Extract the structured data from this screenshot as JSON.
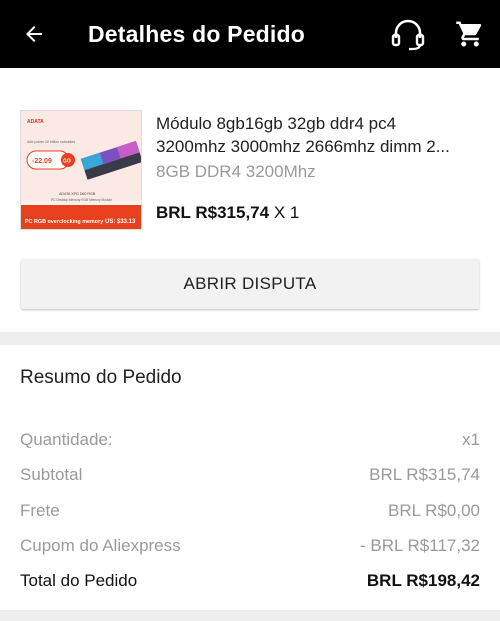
{
  "header": {
    "title": "Detalhes do Pedido"
  },
  "product": {
    "name_line1": "Módulo 8gb16gb 32gb ddr4 pc4",
    "name_line2": "3200mhz 3000mhz 2666mhz dimm 2...",
    "variant": "8GB DDR4 3200Mhz",
    "price": "BRL R$315,74",
    "qty": "X 1",
    "thumb": {
      "brand": "ADATA",
      "promo": "Add points 10 billion subsidies",
      "price_tag": "-22.09",
      "go": "GO",
      "subtitle1": "ADATA XPG D60 RGB",
      "subtitle2": "PC Desktop Memory RGB Memory Module",
      "banner": "PC RGB overclocking memory",
      "us_price": "US: $33.13"
    }
  },
  "dispute_button": "ABRIR DISPUTA",
  "summary": {
    "title": "Resumo do Pedido",
    "rows": [
      {
        "label": "Quantidade:",
        "value": "x1"
      },
      {
        "label": "Subtotal",
        "value": "BRL R$315,74"
      },
      {
        "label": "Frete",
        "value": "BRL R$0,00"
      },
      {
        "label": "Cupom do Aliexpress",
        "value": "- BRL R$117,32"
      }
    ],
    "total_label": "Total do Pedido",
    "total_value": "BRL R$198,42"
  },
  "colors": {
    "header_bg": "#000000",
    "accent_red": "#e8401c",
    "muted_text": "#9a9a9a"
  }
}
